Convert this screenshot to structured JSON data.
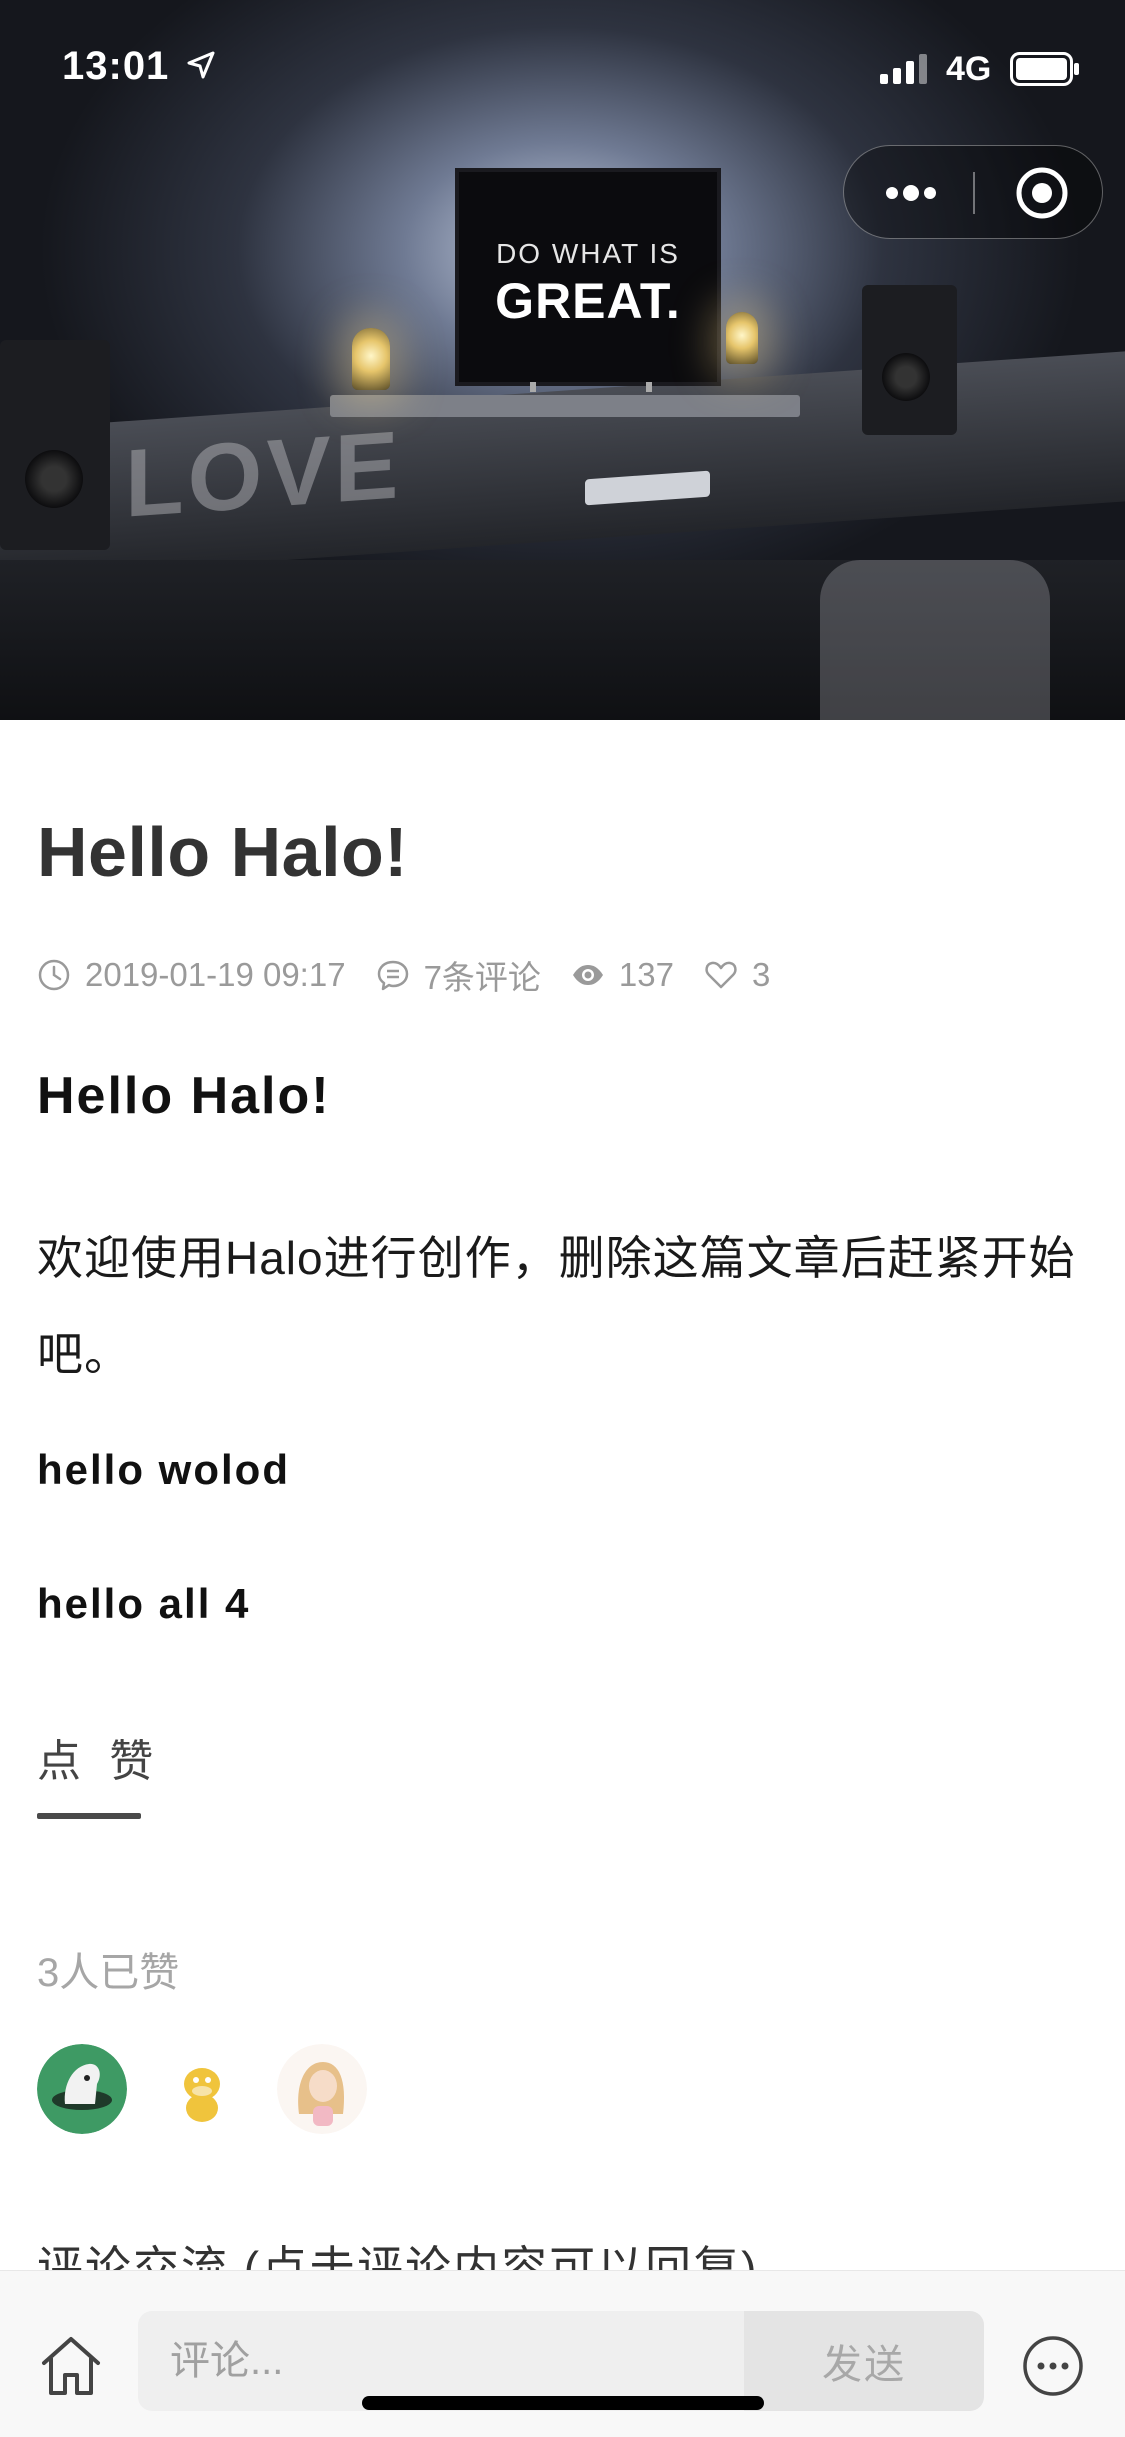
{
  "status_bar": {
    "time": "13:01",
    "network": "4G"
  },
  "hero": {
    "screen_line1": "DO WHAT IS",
    "screen_line2": "GREAT.",
    "desk_sign": "LOVE"
  },
  "article": {
    "title": "Hello Halo!",
    "meta": {
      "date": "2019-01-19 09:17",
      "comments": "7条评论",
      "views": "137",
      "likes": "3"
    },
    "heading": "Hello Halo!",
    "paragraph": "欢迎使用Halo进行创作，删除这篇文章后赶紧开始吧。",
    "subheading1": "hello wolod",
    "subheading2": "hello all 4"
  },
  "likes_section": {
    "tab_label": "点 赞",
    "count_text": "3人已赞"
  },
  "comments_section": {
    "heading": "评论交流 (点击评论内容可以回复)"
  },
  "bottom_bar": {
    "input_placeholder": "评论...",
    "send_label": "发送"
  },
  "colors": {
    "accent_text": "#333333",
    "meta_gray": "#9a9a9a",
    "tab_underline": "#4a4a4a"
  }
}
